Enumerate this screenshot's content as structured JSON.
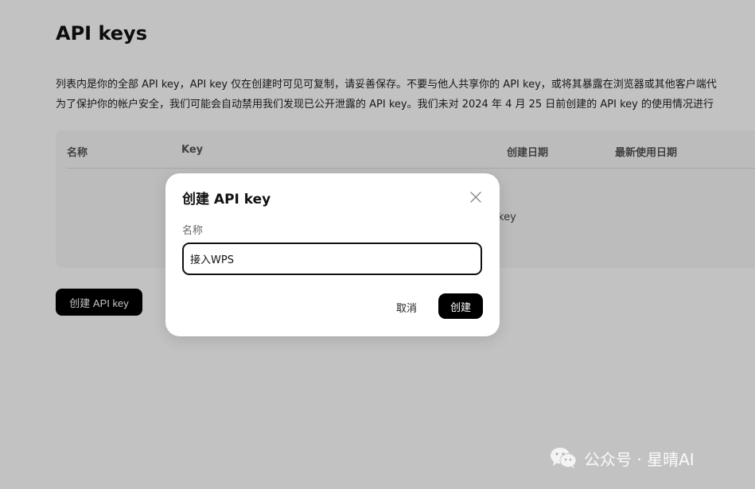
{
  "page": {
    "title": "API keys",
    "description_lines": [
      "列表内是你的全部 API key，API key 仅在创建时可见可复制，请妥善保存。不要与他人共享你的 API key，或将其暴露在浏览器或其他客户端代",
      "为了保护你的帐户安全，我们可能会自动禁用我们发现已公开泄露的 API key。我们未对 2024 年 4 月 25 日前创建的 API key 的使用情况进行"
    ]
  },
  "table": {
    "columns": [
      "名称",
      "Key",
      "创建日期",
      "最新使用日期"
    ],
    "empty_text_fragment": "key"
  },
  "create_button_label": "创建 API key",
  "dialog": {
    "title": "创建 API key",
    "name_label": "名称",
    "name_value": "接入WPS",
    "cancel_label": "取消",
    "confirm_label": "创建",
    "close_icon": "close-icon"
  },
  "watermark": {
    "text": "公众号 · 星晴AI",
    "icon": "wechat-icon"
  },
  "colors": {
    "overlay": "#c2c2c2",
    "button_bg": "#000000",
    "dialog_bg": "#ffffff"
  }
}
